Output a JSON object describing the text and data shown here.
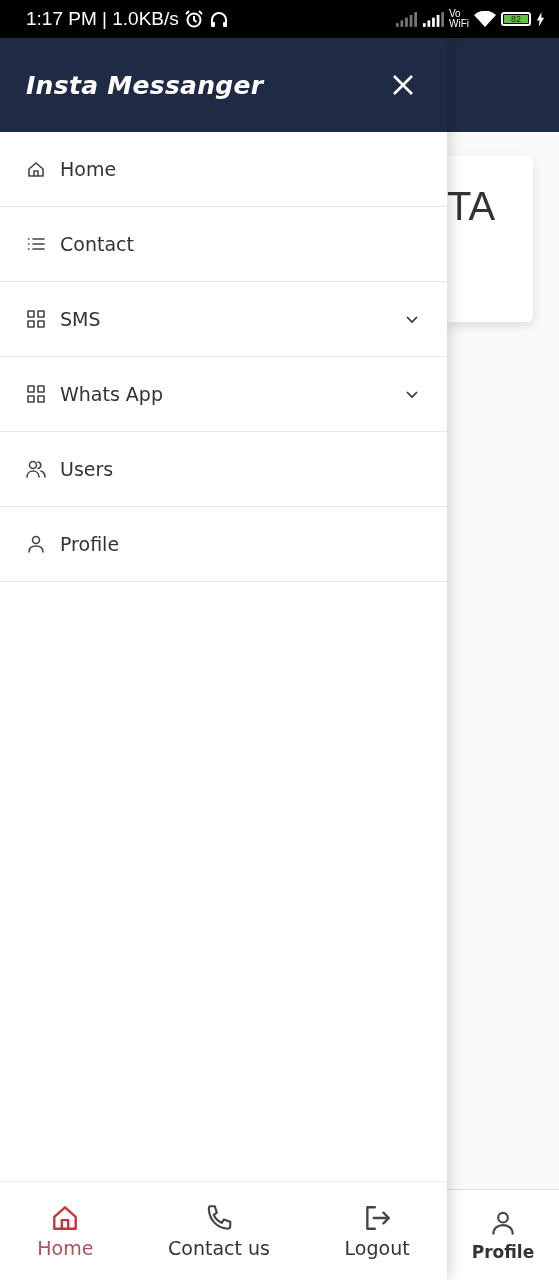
{
  "status_bar": {
    "time_speed": "1:17 PM | 1.0KB/s",
    "vo": "Vo",
    "wifi": "WiFi",
    "battery": "82"
  },
  "drawer": {
    "title": "Insta Messanger",
    "items": [
      {
        "label": "Home",
        "kind": "link"
      },
      {
        "label": "Contact",
        "kind": "link"
      },
      {
        "label": "SMS",
        "kind": "dropdown",
        "expanded": false
      },
      {
        "label": "Whats App",
        "kind": "dropdown",
        "expanded": false
      },
      {
        "label": "Users",
        "kind": "link"
      },
      {
        "label": "Profile",
        "kind": "link"
      }
    ],
    "bottom_nav": [
      {
        "label": "Home",
        "selected": true
      },
      {
        "label": "Contact us",
        "selected": false
      },
      {
        "label": "Logout",
        "selected": false
      }
    ]
  },
  "background": {
    "card_text": "TA",
    "bottom_nav": [
      {
        "label": "Profile"
      }
    ]
  }
}
